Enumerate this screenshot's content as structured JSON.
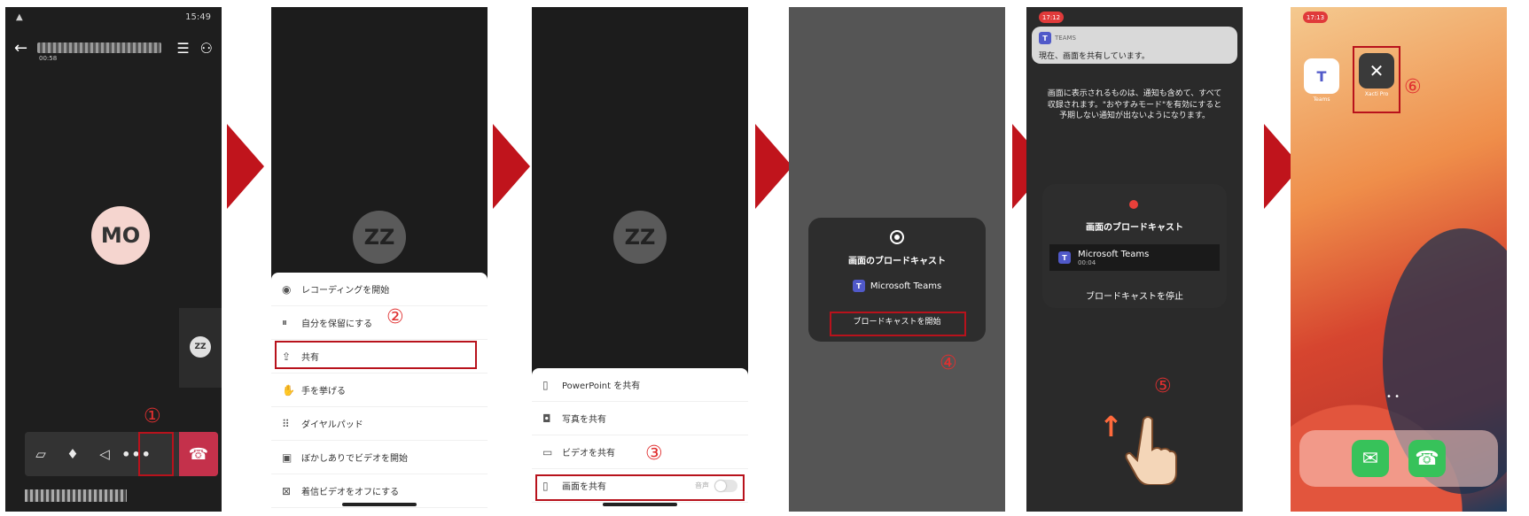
{
  "step1": {
    "status_time": "15:49",
    "duration": "00:58",
    "avatar_initials": "MO",
    "self_initials": "ZZ",
    "step_marker": "①",
    "more_label": "•••"
  },
  "step2": {
    "avatar_initials": "ZZ",
    "menu": [
      {
        "label": "レコーディングを開始",
        "icon": "◉"
      },
      {
        "label": "自分を保留にする",
        "icon": "⏸"
      },
      {
        "label": "共有",
        "icon": "⇪"
      },
      {
        "label": "手を挙げる",
        "icon": "✋"
      },
      {
        "label": "ダイヤルパッド",
        "icon": "⠿"
      },
      {
        "label": "ぼかしありでビデオを開始",
        "icon": "▣"
      },
      {
        "label": "着信ビデオをオフにする",
        "icon": "⊠"
      }
    ],
    "step_marker": "②"
  },
  "step3": {
    "avatar_initials": "ZZ",
    "menu": [
      {
        "label": "PowerPoint を共有",
        "icon": "▯"
      },
      {
        "label": "写真を共有",
        "icon": "◘"
      },
      {
        "label": "ビデオを共有",
        "icon": "▭"
      },
      {
        "label": "画面を共有",
        "icon": "▯"
      }
    ],
    "audio_label": "音声",
    "step_marker": "③"
  },
  "step4": {
    "title": "画面のブロードキャスト",
    "app_name": "Microsoft Teams",
    "start_label": "ブロードキャストを開始",
    "step_marker": "④"
  },
  "step5": {
    "time": "17:12",
    "notif_app": "TEAMS",
    "notif_message": "現在、画面を共有しています。",
    "body_text": "画面に表示されるものは、通知も含めて、すべて収録されます。\"おやすみモード\"を有効にすると予期しない通知が出ないようになります。",
    "title": "画面のブロードキャスト",
    "app_name": "Microsoft Teams",
    "elapsed": "00:04",
    "stop_label": "ブロードキャストを停止",
    "step_marker": "⑤"
  },
  "step6": {
    "time": "17:13",
    "teams_label": "Teams",
    "xacti_label": "Xacti Pro",
    "step_marker": "⑥"
  },
  "colors": {
    "arrow": "#c0141c",
    "highlight_box": "#b8121c",
    "step_marker": "#e03030",
    "hangup": "#c4314b"
  }
}
